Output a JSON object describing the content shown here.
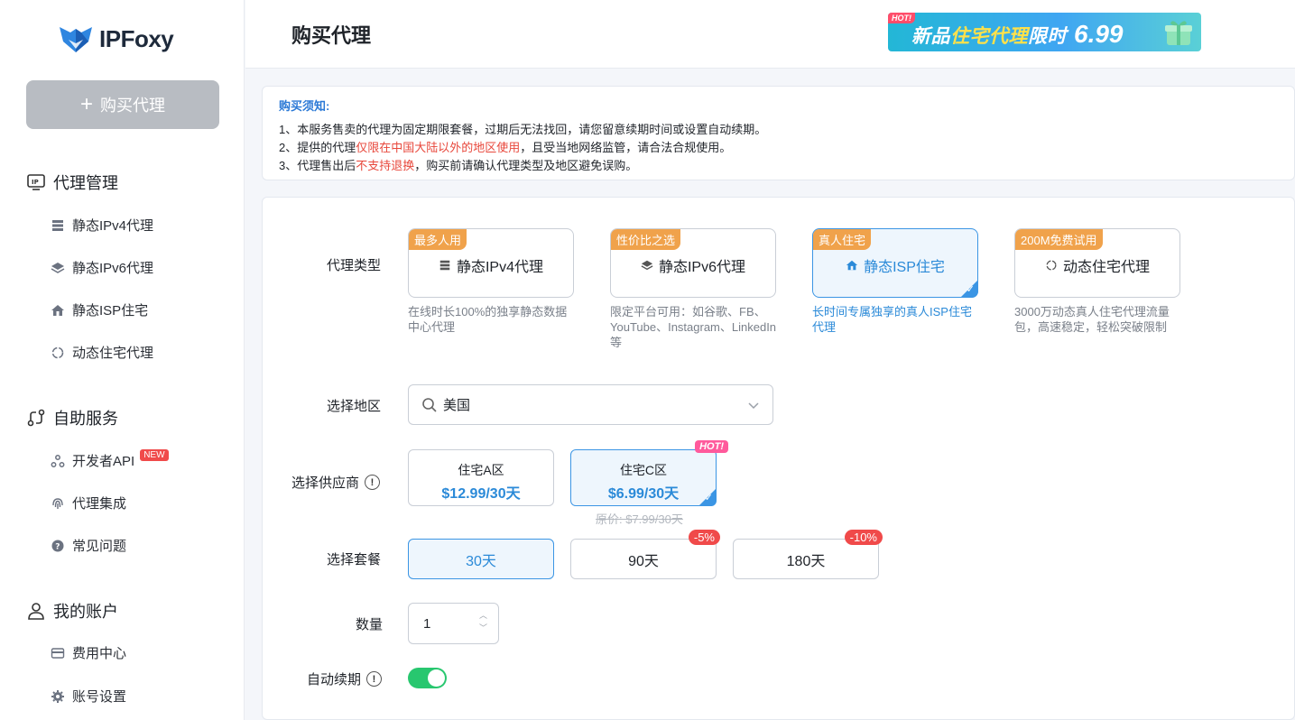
{
  "brand": {
    "name": "IPFoxy"
  },
  "sidebar": {
    "buy_button": "购买代理",
    "groups": [
      {
        "label": "代理管理",
        "items": [
          "静态IPv4代理",
          "静态IPv6代理",
          "静态ISP住宅",
          "动态住宅代理"
        ]
      },
      {
        "label": "自助服务",
        "items": [
          "开发者API",
          "代理集成",
          "常见问题"
        ],
        "new_badge": "NEW"
      },
      {
        "label": "我的账户",
        "items": [
          "费用中心",
          "账号设置"
        ]
      }
    ]
  },
  "header": {
    "title": "购买代理",
    "promo": {
      "hot": "HOT!",
      "text_a": "新品",
      "text_b": "住宅代理",
      "text_c": "限时",
      "price": "6.99"
    }
  },
  "notice": {
    "title": "购买须知:",
    "line1": "1、本服务售卖的代理为固定期限套餐，过期后无法找回，请您留意续期时间或设置自动续期。",
    "line2_a": "2、提供的代理",
    "line2_red": "仅限在中国大陆以外的地区使用",
    "line2_b": "，且受当地网络监管，请合法合规使用。",
    "line3_a": "3、代理售出后",
    "line3_red": "不支持退换",
    "line3_b": "，购买前请确认代理类型及地区避免误购。"
  },
  "form": {
    "type_label": "代理类型",
    "types": [
      {
        "tag": "最多人用",
        "name": "静态IPv4代理",
        "desc": "在线时长100%的独享静态数据中心代理"
      },
      {
        "tag": "性价比之选",
        "name": "静态IPv6代理",
        "desc": "限定平台可用：如谷歌、FB、YouTube、Instagram、LinkedIn等"
      },
      {
        "tag": "真人住宅",
        "name": "静态ISP住宅",
        "desc": "长时间专属独享的真人ISP住宅代理"
      },
      {
        "tag": "200M免费试用",
        "name": "动态住宅代理",
        "desc": "3000万动态真人住宅代理流量包，高速稳定，轻松突破限制"
      }
    ],
    "region_label": "选择地区",
    "region_value": "美国",
    "supplier_label": "选择供应商",
    "suppliers": [
      {
        "name": "住宅A区",
        "price": "$12.99/30天"
      },
      {
        "name": "住宅C区",
        "price": "$6.99/30天",
        "hot": "HOT!",
        "original": "原价: $7.99/30天"
      }
    ],
    "package_label": "选择套餐",
    "packages": [
      {
        "label": "30天"
      },
      {
        "label": "90天",
        "discount": "-5%"
      },
      {
        "label": "180天",
        "discount": "-10%"
      }
    ],
    "qty_label": "数量",
    "qty_value": "1",
    "auto_renew_label": "自动续期",
    "auto_renew_on": true
  },
  "colors": {
    "accent": "#3b95e4",
    "tag_orange": "#f0a24b",
    "toggle_on": "#28c76f",
    "red": "#e8473b"
  }
}
